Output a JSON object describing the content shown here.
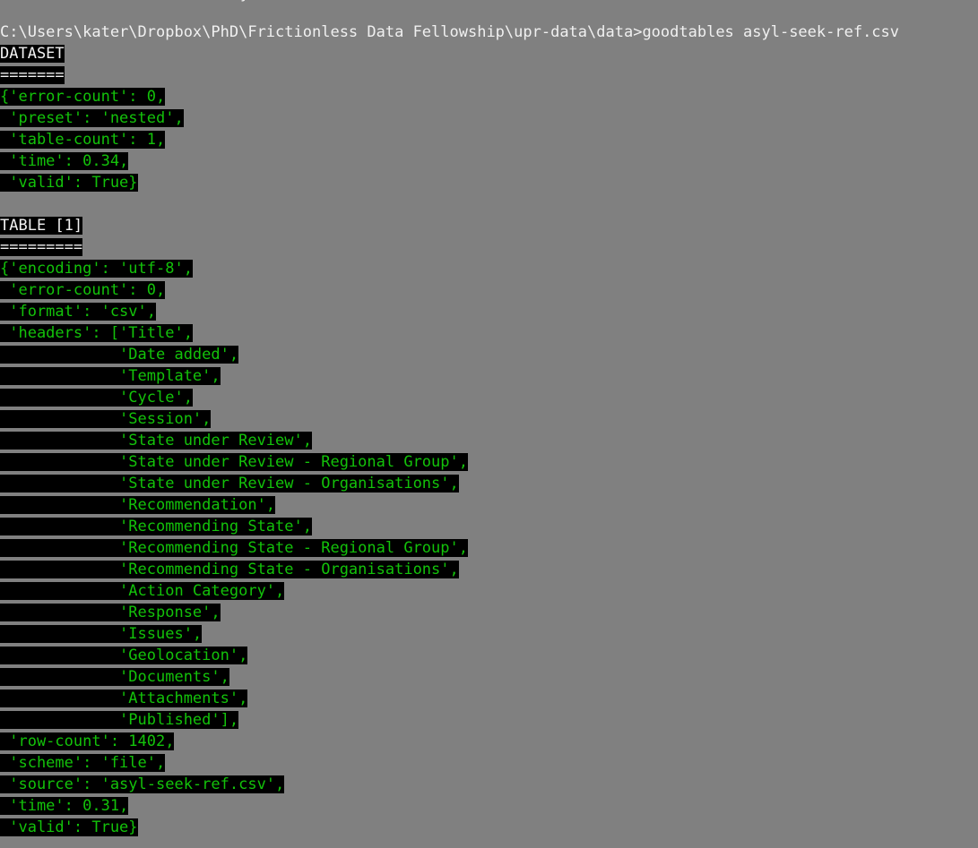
{
  "terminal": {
    "window_kind": "windows-command-prompt",
    "background_color": "#808080",
    "prompt_text_color": "#f0f0f0",
    "output_background_color": "#000000",
    "output_green_color": "#13c20a",
    "output_white_color": "#f2f2f2",
    "scroll_remnant_glyph": "y"
  },
  "command_line": {
    "prompt_path": "C:\\Users\\kater\\Dropbox\\PhD\\Frictionless Data Fellowship\\upr-data\\data",
    "prompt_symbol": ">",
    "command": "goodtables asyl-seek-ref.csv",
    "full_text": "C:\\Users\\kater\\Dropbox\\PhD\\Frictionless Data Fellowship\\upr-data\\data>goodtables asyl-seek-ref.csv"
  },
  "dataset_section": {
    "heading": "DATASET",
    "underline": "=======",
    "report": {
      "error-count": "0",
      "preset": "nested",
      "table-count": "1",
      "time": "0.34",
      "valid": "True"
    },
    "lines": [
      "{'error-count': 0,",
      " 'preset': 'nested',",
      " 'table-count': 1,",
      " 'time': 0.34,",
      " 'valid': True}"
    ]
  },
  "table_section": {
    "heading": "TABLE [1]",
    "underline": "=========",
    "report": {
      "encoding": "utf-8",
      "error-count": "0",
      "format": "csv",
      "row-count": "1402",
      "scheme": "file",
      "source": "asyl-seek-ref.csv",
      "time": "0.31",
      "valid": "True"
    },
    "headers": [
      "Title",
      "Date added",
      "Template",
      "Cycle",
      "Session",
      "State under Review",
      "State under Review - Regional Group",
      "State under Review - Organisations",
      "Recommendation",
      "Recommending State",
      "Recommending State - Regional Group",
      "Recommending State - Organisations",
      "Action Category",
      "Response",
      "Issues",
      "Geolocation",
      "Documents",
      "Attachments",
      "Published"
    ],
    "lines": [
      "{'encoding': 'utf-8',",
      " 'error-count': 0,",
      " 'format': 'csv',",
      " 'headers': ['Title',",
      "             'Date added',",
      "             'Template',",
      "             'Cycle',",
      "             'Session',",
      "             'State under Review',",
      "             'State under Review - Regional Group',",
      "             'State under Review - Organisations',",
      "             'Recommendation',",
      "             'Recommending State',",
      "             'Recommending State - Regional Group',",
      "             'Recommending State - Organisations',",
      "             'Action Category',",
      "             'Response',",
      "             'Issues',",
      "             'Geolocation',",
      "             'Documents',",
      "             'Attachments',",
      "             'Published'],",
      " 'row-count': 1402,",
      " 'scheme': 'file',",
      " 'source': 'asyl-seek-ref.csv',",
      " 'time': 0.31,",
      " 'valid': True}"
    ]
  },
  "screen_rows": [
    {
      "kind": "prompt",
      "text": "C:\\Users\\kater\\Dropbox\\PhD\\Frictionless Data Fellowship\\upr-data\\data>goodtables asyl-seek-ref.csv",
      "name": "command-prompt-line"
    },
    {
      "kind": "white",
      "text": "DATASET",
      "name": "dataset-heading"
    },
    {
      "kind": "white",
      "text": "=======",
      "name": "dataset-heading-underline"
    },
    {
      "kind": "green",
      "text": "{'error-count': 0,",
      "name": "dataset-error-count-line"
    },
    {
      "kind": "green",
      "text": " 'preset': 'nested',",
      "name": "dataset-preset-line"
    },
    {
      "kind": "green",
      "text": " 'table-count': 1,",
      "name": "dataset-table-count-line"
    },
    {
      "kind": "green",
      "text": " 'time': 0.34,",
      "name": "dataset-time-line"
    },
    {
      "kind": "green",
      "text": " 'valid': True}",
      "name": "dataset-valid-line"
    },
    {
      "kind": "blank",
      "text": "",
      "name": "blank-separator-line"
    },
    {
      "kind": "white",
      "text": "TABLE [1]",
      "name": "table-heading"
    },
    {
      "kind": "white",
      "text": "=========",
      "name": "table-heading-underline"
    },
    {
      "kind": "green",
      "text": "{'encoding': 'utf-8',",
      "name": "table-encoding-line"
    },
    {
      "kind": "green",
      "text": " 'error-count': 0,",
      "name": "table-error-count-line"
    },
    {
      "kind": "green",
      "text": " 'format': 'csv',",
      "name": "table-format-line"
    },
    {
      "kind": "green",
      "text": " 'headers': ['Title',",
      "name": "table-headers-line-1"
    },
    {
      "kind": "green",
      "text": "             'Date added',",
      "name": "table-headers-line-2"
    },
    {
      "kind": "green",
      "text": "             'Template',",
      "name": "table-headers-line-3"
    },
    {
      "kind": "green",
      "text": "             'Cycle',",
      "name": "table-headers-line-4"
    },
    {
      "kind": "green",
      "text": "             'Session',",
      "name": "table-headers-line-5"
    },
    {
      "kind": "green",
      "text": "             'State under Review',",
      "name": "table-headers-line-6"
    },
    {
      "kind": "green",
      "text": "             'State under Review - Regional Group',",
      "name": "table-headers-line-7"
    },
    {
      "kind": "green",
      "text": "             'State under Review - Organisations',",
      "name": "table-headers-line-8"
    },
    {
      "kind": "green",
      "text": "             'Recommendation',",
      "name": "table-headers-line-9"
    },
    {
      "kind": "green",
      "text": "             'Recommending State',",
      "name": "table-headers-line-10"
    },
    {
      "kind": "green",
      "text": "             'Recommending State - Regional Group',",
      "name": "table-headers-line-11"
    },
    {
      "kind": "green",
      "text": "             'Recommending State - Organisations',",
      "name": "table-headers-line-12"
    },
    {
      "kind": "green",
      "text": "             'Action Category',",
      "name": "table-headers-line-13"
    },
    {
      "kind": "green",
      "text": "             'Response',",
      "name": "table-headers-line-14"
    },
    {
      "kind": "green",
      "text": "             'Issues',",
      "name": "table-headers-line-15"
    },
    {
      "kind": "green",
      "text": "             'Geolocation',",
      "name": "table-headers-line-16"
    },
    {
      "kind": "green",
      "text": "             'Documents',",
      "name": "table-headers-line-17"
    },
    {
      "kind": "green",
      "text": "             'Attachments',",
      "name": "table-headers-line-18"
    },
    {
      "kind": "green",
      "text": "             'Published'],",
      "name": "table-headers-line-19"
    },
    {
      "kind": "green",
      "text": " 'row-count': 1402,",
      "name": "table-row-count-line"
    },
    {
      "kind": "green",
      "text": " 'scheme': 'file',",
      "name": "table-scheme-line"
    },
    {
      "kind": "green",
      "text": " 'source': 'asyl-seek-ref.csv',",
      "name": "table-source-line"
    },
    {
      "kind": "green",
      "text": " 'time': 0.31,",
      "name": "table-time-line"
    },
    {
      "kind": "green",
      "text": " 'valid': True}",
      "name": "table-valid-line"
    }
  ]
}
